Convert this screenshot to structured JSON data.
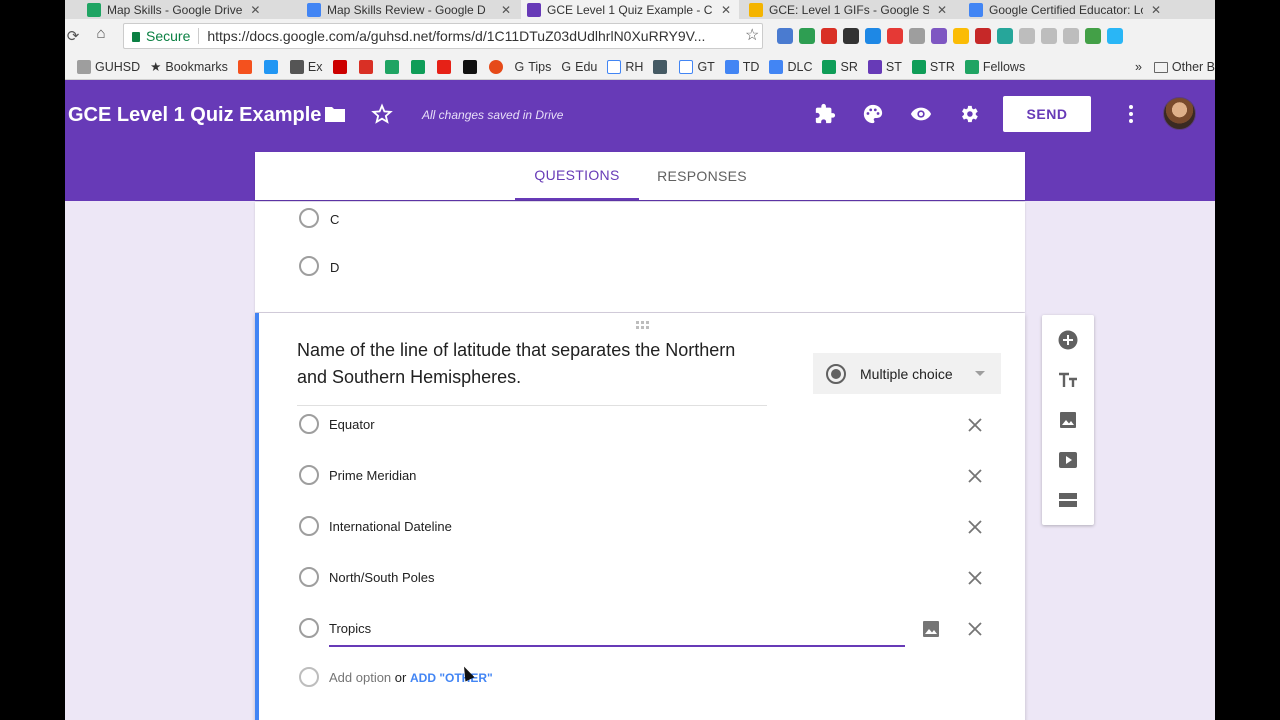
{
  "browser": {
    "tabs": [
      {
        "title": "Map Skills - Google Drive",
        "color": "#1fa463"
      },
      {
        "title": "Map Skills Review - Google D",
        "color": "#4285f4"
      },
      {
        "title": "GCE Level 1 Quiz Example - C",
        "color": "#673ab7"
      },
      {
        "title": "GCE: Level 1 GIFs - Google S",
        "color": "#f4b400"
      },
      {
        "title": "Google Certified Educator: Lc",
        "color": "#4285f4"
      }
    ],
    "close_glyph": "✕",
    "secure_label": "Secure",
    "url": "https://docs.google.com/a/guhsd.net/forms/d/1C11DTuZ03dUdlhrlN0XuRRY9V...",
    "bookmarks": [
      "GUHSD",
      "Bookmarks",
      "Ex",
      "Tips",
      "Edu",
      "RH",
      "GT",
      "TD",
      "DLC",
      "SR",
      "ST",
      "STR",
      "Fellows"
    ],
    "more_glyph": "»",
    "other_bookmarks": "Other B"
  },
  "form_header": {
    "title": "GCE Level 1 Quiz Example",
    "saved_status": "All changes saved in Drive",
    "send_label": "SEND",
    "accent": "#673ab7"
  },
  "form_tabs": {
    "questions": "QUESTIONS",
    "responses": "RESPONSES"
  },
  "previous_question": {
    "options": [
      "C",
      "D"
    ]
  },
  "question": {
    "title": "Name of the line of latitude that separates the Northern and Southern Hemispheres.",
    "type": "Multiple choice",
    "options": [
      "Equator",
      "Prime Meridian",
      "International Dateline",
      "North/South Poles",
      "Tropics"
    ],
    "add_option": "Add option",
    "or": "or",
    "add_other": "ADD \"OTHER\""
  }
}
